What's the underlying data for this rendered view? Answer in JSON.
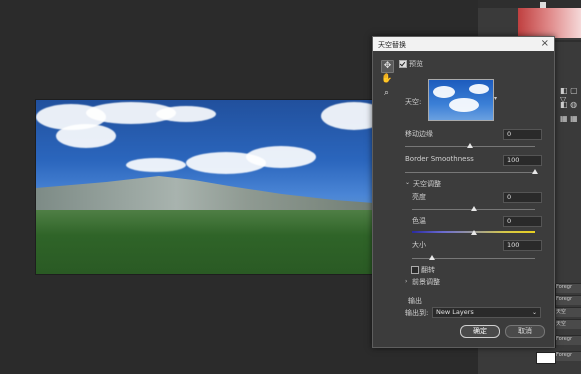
{
  "dialog": {
    "title": "天空替换",
    "close_glyph": "×",
    "preview_label": "预览",
    "sky_label": "天空:",
    "shift_edge": {
      "label": "移动边缘",
      "value": "0",
      "level": 0.5
    },
    "fade_edge": {
      "label": "Border Smoothness",
      "value": "100",
      "level": 1.0
    },
    "sky_adjust_section": "天空调整",
    "brightness": {
      "label": "亮度",
      "value": "0",
      "level": 0.5
    },
    "temperature": {
      "label": "色温",
      "value": "0",
      "level": 0.5
    },
    "scale": {
      "label": "大小",
      "value": "100",
      "level": 0.2
    },
    "flip_label": "翻转",
    "lighting_section": "前景调整",
    "output_heading": "输出",
    "output_to_label": "输出到:",
    "output_to_value": "New Layers",
    "ok_label": "确定",
    "cancel_label": "取消"
  },
  "layers_panel": {
    "rows": [
      "Foregr",
      "Foregr",
      "天空",
      "天空",
      "Foregr",
      "Foregr"
    ]
  },
  "colors": {
    "dialog_bg": "#3c3c3c",
    "workspace_bg": "#2b2b2b",
    "titlebar_bg": "#f2f2f2"
  },
  "icons": [
    "move-tool-icon",
    "hand-tool-icon",
    "zoom-tool-icon",
    "close-icon",
    "chevron-down-icon",
    "chevron-right-icon"
  ]
}
